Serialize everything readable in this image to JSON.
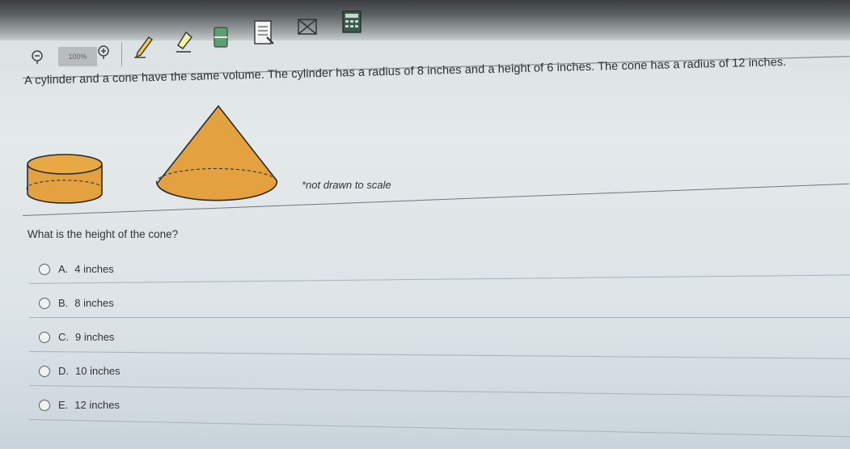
{
  "toolbar": {
    "zoom_label": "100%",
    "tools": [
      {
        "name": "zoom-out-icon"
      },
      {
        "name": "zoom-in-icon"
      },
      {
        "name": "pencil-icon"
      },
      {
        "name": "highlighter-icon"
      },
      {
        "name": "eraser-icon"
      },
      {
        "name": "notepad-icon"
      },
      {
        "name": "answer-eliminator-icon"
      },
      {
        "name": "calculator-icon"
      }
    ]
  },
  "question": {
    "text": "A cylinder and a cone have the same volume. The cylinder has a radius of 8 inches and a height of 6 inches. The cone has a radius of 12 inches.",
    "figure_note": "*not drawn to scale",
    "prompt": "What is the height of the cone?",
    "fill_color": "#e3a13f"
  },
  "choices": [
    {
      "letter": "A.",
      "text": "4 inches"
    },
    {
      "letter": "B.",
      "text": "8 inches"
    },
    {
      "letter": "C.",
      "text": "9 inches"
    },
    {
      "letter": "D.",
      "text": "10 inches"
    },
    {
      "letter": "E.",
      "text": "12 inches"
    }
  ]
}
